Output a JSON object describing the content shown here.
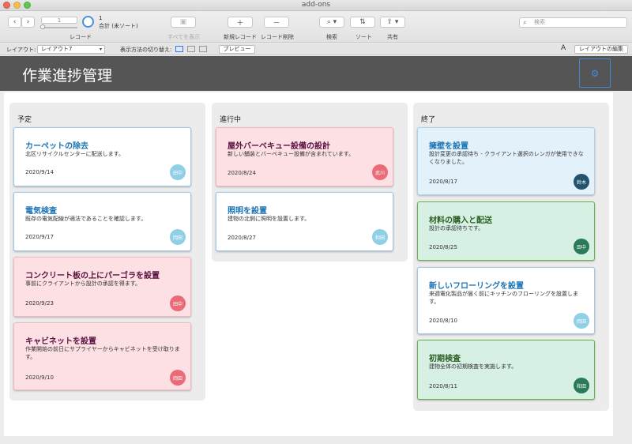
{
  "window": {
    "title": "add-ons"
  },
  "toolbar": {
    "record_current": "1",
    "record_count": "1",
    "record_total": "合計 (未ソート)",
    "records_label": "レコード",
    "show_all": "すべてを表示",
    "new_record": "新規レコード",
    "delete_record": "レコード削除",
    "find": "検索",
    "sort": "ソート",
    "share": "共有",
    "search_placeholder": "検索"
  },
  "layout_bar": {
    "layout_label": "レイアウト:",
    "layout_value": "レイアウト7",
    "view_switch_label": "表示方法の切り替え:",
    "preview": "プレビュー",
    "font_icon": "A",
    "edit_layout": "レイアウトの編集"
  },
  "header": {
    "title": "作業進捗管理"
  },
  "columns": [
    {
      "title": "予定",
      "cards": [
        {
          "title": "カーペットの除去",
          "desc": "北区リサイクルセンターに配送します。",
          "date": "2020/9/14",
          "assignee": "田中"
        },
        {
          "title": "電気検査",
          "desc": "既存の電気配線が適法であることを確認します。",
          "date": "2020/9/17",
          "assignee": "岡田"
        },
        {
          "title": "コンクリート板の上にパーゴラを設置",
          "desc": "事前にクライアントから設計の承認を得ます。",
          "date": "2020/9/23",
          "assignee": "田中"
        },
        {
          "title": "キャビネットを設置",
          "desc": "作業開始の前日にサプライヤーからキャビネットを受け取ります。",
          "date": "2020/9/10",
          "assignee": "岡田"
        }
      ]
    },
    {
      "title": "進行中",
      "cards": [
        {
          "title": "屋外バーベキュー設備の設計",
          "desc": "新しい舗装とバーベキュー設備が含まれています。",
          "date": "2020/8/24",
          "assignee": "武川"
        },
        {
          "title": "照明を設置",
          "desc": "建物の北側に照明を設置します。",
          "date": "2020/8/27",
          "assignee": "和田"
        }
      ]
    },
    {
      "title": "終了",
      "cards": [
        {
          "title": "擁壁を設置",
          "desc": "設計変更の承認待ち - クライアント選択のレンガが使用できなくなりました。",
          "date": "2020/8/17",
          "assignee": "鈴木"
        },
        {
          "title": "材料の購入と配送",
          "desc": "設計の承認待ちです。",
          "date": "2020/8/25",
          "assignee": "田中"
        },
        {
          "title": "新しいフローリングを設置",
          "desc": "来週電化製品が届く前にキッチンのフローリングを設置します。",
          "date": "2020/8/10",
          "assignee": "岡田"
        },
        {
          "title": "初期検査",
          "desc": "建物全体の初期検査を実施します。",
          "date": "2020/8/11",
          "assignee": "和田"
        }
      ]
    }
  ]
}
